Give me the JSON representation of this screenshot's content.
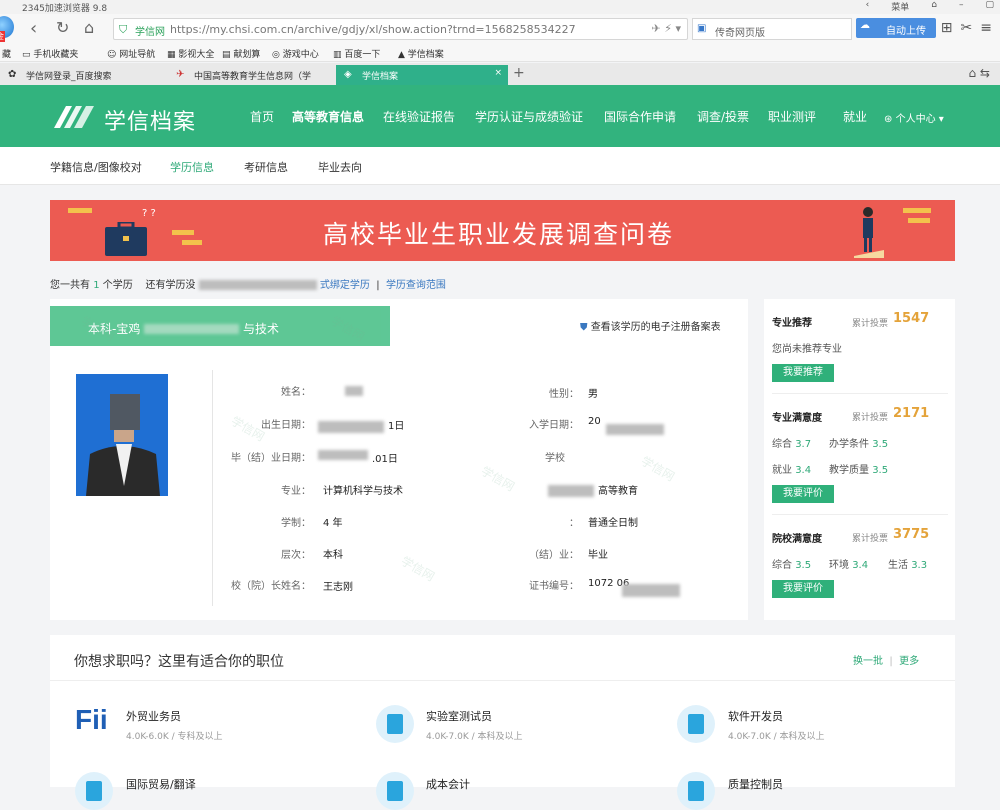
{
  "browser": {
    "app_title": "2345加速浏览器 9.8",
    "window_menu": "菜单",
    "logo_badge": "金",
    "address": {
      "site_tag": "学信网",
      "url": "https://my.chsi.com.cn/archive/gdjy/xl/show.action?trnd=1568258534227"
    },
    "search_placeholder": "传奇网页版",
    "upload_label": "自动上传",
    "favorites": [
      "藏",
      "手机收藏夹",
      "网址导航",
      "影视大全",
      "献划算",
      "游戏中心",
      "百度一下",
      "学信档案"
    ],
    "tabs": [
      {
        "label": "学信网登录_百度搜索"
      },
      {
        "label": "中国高等教育学生信息网（学"
      },
      {
        "label": "学信档案"
      }
    ],
    "new_tab": "+"
  },
  "site": {
    "brand": "学信档案",
    "nav": [
      "首页",
      "高等教育信息",
      "在线验证报告",
      "学历认证与成绩验证",
      "国际合作申请",
      "调查/投票",
      "职业测评",
      "就业"
    ],
    "user_center": "个人中心",
    "subnav": [
      "学籍信息/图像校对",
      "学历信息",
      "考研信息",
      "毕业去向"
    ]
  },
  "banner": {
    "title": "高校毕业生职业发展调查问卷"
  },
  "summary": {
    "prefix": "您一共有",
    "count": "1",
    "suffix": "个学历",
    "more": "还有学历没",
    "bind_link": "式绑定学历",
    "sep": "|",
    "range_link": "学历查询范围"
  },
  "degree": {
    "header": "本科-宝鸡",
    "header_tail": "与技术",
    "cert_link": "查看该学历的电子注册备案表",
    "watermark": "学信网",
    "fields_left": [
      {
        "label": "姓名：",
        "value": ""
      },
      {
        "label": "出生日期：",
        "value": "1日"
      },
      {
        "label": "毕（结）业日期：",
        "value": ".01日"
      },
      {
        "label": "专业：",
        "value": "计算机科学与技术"
      },
      {
        "label": "学制：",
        "value": "4 年"
      },
      {
        "label": "层次：",
        "value": "本科"
      },
      {
        "label": "校（院）长姓名：",
        "value": "王志刚"
      }
    ],
    "fields_right": [
      {
        "label": "性别：",
        "value": "男"
      },
      {
        "label": "入学日期：",
        "value": "20"
      },
      {
        "label": "学校",
        "value": ""
      },
      {
        "label": "",
        "value": "高等教育"
      },
      {
        "label": "：",
        "value": "普通全日制"
      },
      {
        "label": "（结）业：",
        "value": "毕业"
      },
      {
        "label": "证书编号：",
        "value": "1072          06"
      }
    ]
  },
  "sidebar": {
    "recommend": {
      "title": "专业推荐",
      "votes_label": "累计投票",
      "votes": "1547",
      "note": "您尚未推荐专业",
      "button": "我要推荐"
    },
    "major_satisfaction": {
      "title": "专业满意度",
      "votes_label": "累计投票",
      "votes": "2171",
      "rows": [
        [
          {
            "k": "综合",
            "v": "3.7"
          },
          {
            "k": "办学条件",
            "v": "3.5"
          }
        ],
        [
          {
            "k": "就业",
            "v": "3.4"
          },
          {
            "k": "教学质量",
            "v": "3.5"
          }
        ]
      ],
      "button": "我要评价"
    },
    "school_satisfaction": {
      "title": "院校满意度",
      "votes_label": "累计投票",
      "votes": "3775",
      "rows": [
        [
          {
            "k": "综合",
            "v": "3.5"
          },
          {
            "k": "环境",
            "v": "3.4"
          },
          {
            "k": "生活",
            "v": "3.3"
          }
        ]
      ],
      "button": "我要评价"
    }
  },
  "jobs": {
    "title": "你想求职吗？这里有适合你的职位",
    "refresh": "换一批",
    "sep": "|",
    "more": "更多",
    "items": [
      {
        "name": "外贸业务员",
        "desc": "4.0K-6.0K / 专科及以上",
        "logo": "Fii"
      },
      {
        "name": "实验室测试员",
        "desc": "4.0K-7.0K / 本科及以上"
      },
      {
        "name": "软件开发员",
        "desc": "4.0K-7.0K / 本科及以上"
      },
      {
        "name": "国际贸易/翻译",
        "desc": ""
      },
      {
        "name": "成本会计",
        "desc": ""
      },
      {
        "name": "质量控制员",
        "desc": ""
      }
    ]
  },
  "colors": {
    "brand_green": "#32b37e",
    "banner_red": "#ec5b52",
    "vote_orange": "#e4a33a"
  }
}
